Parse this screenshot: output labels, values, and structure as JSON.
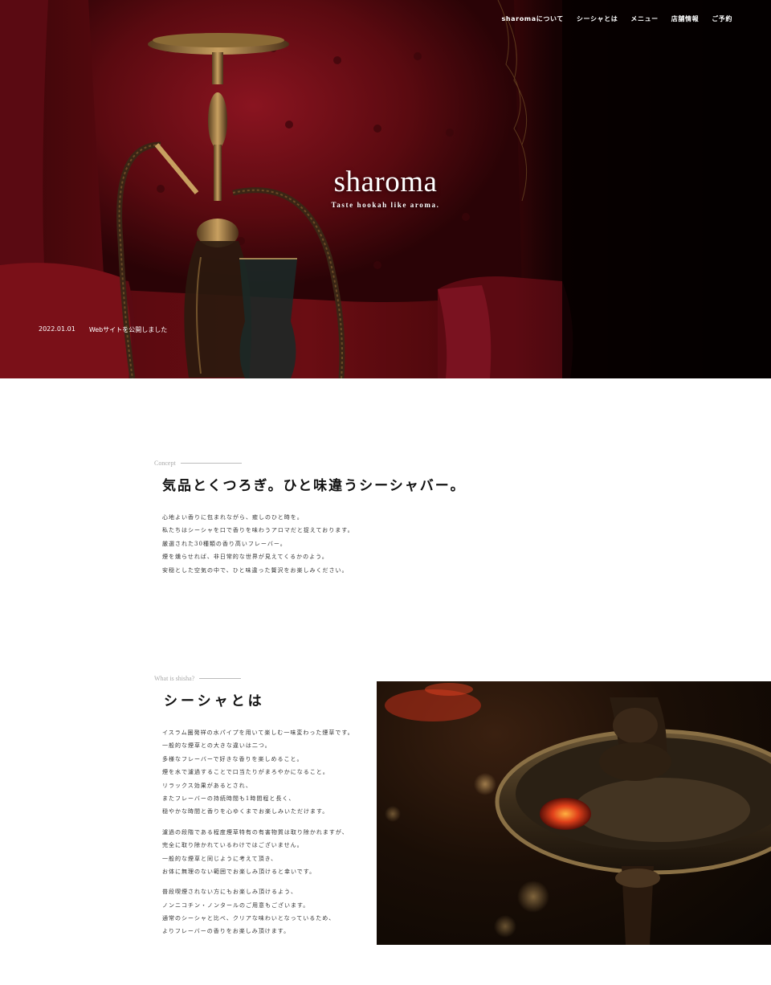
{
  "nav": {
    "items": [
      {
        "label": "sharomaについて"
      },
      {
        "label": "シーシャとは"
      },
      {
        "label": "メニュー"
      },
      {
        "label": "店舗情報"
      },
      {
        "label": "ご予約"
      }
    ]
  },
  "hero": {
    "logo": "sharoma",
    "tagline": "Taste hookah like aroma.",
    "news": {
      "date": "2022.01.01",
      "text": "Webサイトを公開しました"
    }
  },
  "concept": {
    "label": "Concept",
    "title": "気品とくつろぎ。ひと味違うシーシャバー。",
    "lines": [
      "心地よい香りに包まれながら、癒しのひと時を。",
      "私たちはシーシャを口で香りを味わうアロマだと捉えております。",
      "厳選された30種類の香り高いフレーバー。",
      "煙を燻らせれば、非日常的な世界が見えてくるかのよう。",
      "安穏とした空気の中で、ひと味違った贅沢をお楽しみください。"
    ]
  },
  "shisha": {
    "label": "What is shisha?",
    "title": "シーシャとは",
    "paragraphs": [
      [
        "イスラム圏発祥の水パイプを用いて楽しむ一味変わった煙草です。",
        "一般的な煙草との大きな違いは二つ。",
        "多様なフレーバーで好きな香りを楽しめること。",
        "煙を水で濾過することで口当たりがまろやかになること。",
        "リラックス効果があるとされ、",
        "またフレーバーの持続時間も1時間程と長く、",
        "穏やかな時間と香りを心ゆくまでお楽しみいただけます。"
      ],
      [
        "濾過の段階である程度煙草特有の有害物質は取り除かれますが、",
        "完全に取り除かれているわけではございません。",
        "一般的な煙草と同じように考えて頂き、",
        "お体に無理のない範囲でお楽しみ頂けると幸いです。"
      ],
      [
        "普段喫煙されない方にもお楽しみ頂けるよう、",
        "ノンニコチン・ノンタールのご用意もございます。",
        "通常のシーシャと比べ、クリアな味わいとなっているため、",
        "よりフレーバーの香りをお楽しみ頂けます。"
      ]
    ]
  },
  "colors": {
    "hero_red": "#6a0d13",
    "text_dark": "#111111",
    "label_gray": "#aaaaaa"
  },
  "icons": [
    "hookah-illustration",
    "shisha-bowl-photo"
  ]
}
